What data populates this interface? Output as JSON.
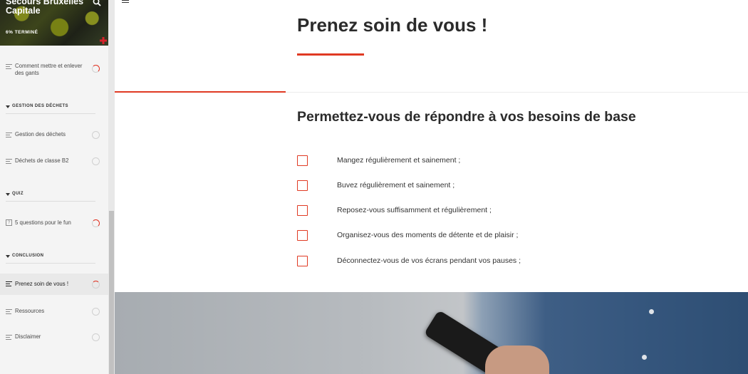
{
  "sidebar": {
    "course_title": "Secours Bruxelles Capitale",
    "progress_text": "6% TERMINÉ",
    "sections": [
      {
        "title": "GESTION DES DÉCHETS"
      },
      {
        "title": "QUIZ"
      },
      {
        "title": "CONCLUSION"
      }
    ],
    "lessons": [
      {
        "label": "Comment mettre et enlever des gants",
        "status": "in-progress"
      },
      {
        "label": "Gestion des déchets",
        "status": "not-started"
      },
      {
        "label": "Déchets de classe B2",
        "status": "not-started"
      },
      {
        "label": "5 questions pour le fun",
        "status": "in-progress"
      },
      {
        "label": "Prenez soin de vous !",
        "status": "in-progress",
        "active": true
      },
      {
        "label": "Ressources",
        "status": "not-started"
      },
      {
        "label": "Disclaimer",
        "status": "not-started"
      }
    ],
    "quiz_icon_glyph": "?"
  },
  "main": {
    "title": "Prenez soin de vous !",
    "lesson_progress_fraction": 0.27,
    "heading": "Permettez-vous de répondre à vos besoins de base",
    "checklist": [
      " Mangez régulièrement et sainement ;",
      "Buvez régulièrement et sainement ;",
      "Reposez-vous suffisamment et régulièrement ;",
      "Organisez-vous des moments de détente et de plaisir ;",
      "Déconnectez-vous de vos écrans pendant vos pauses ;"
    ]
  },
  "colors": {
    "accent": "#e03a23",
    "sidebar_bg": "#f4f4f4",
    "text": "#2b2b2b"
  },
  "icons": {
    "menu": "hamburger-icon",
    "search": "search-icon",
    "lesson": "lesson-lines-icon",
    "quiz": "quiz-icon"
  }
}
